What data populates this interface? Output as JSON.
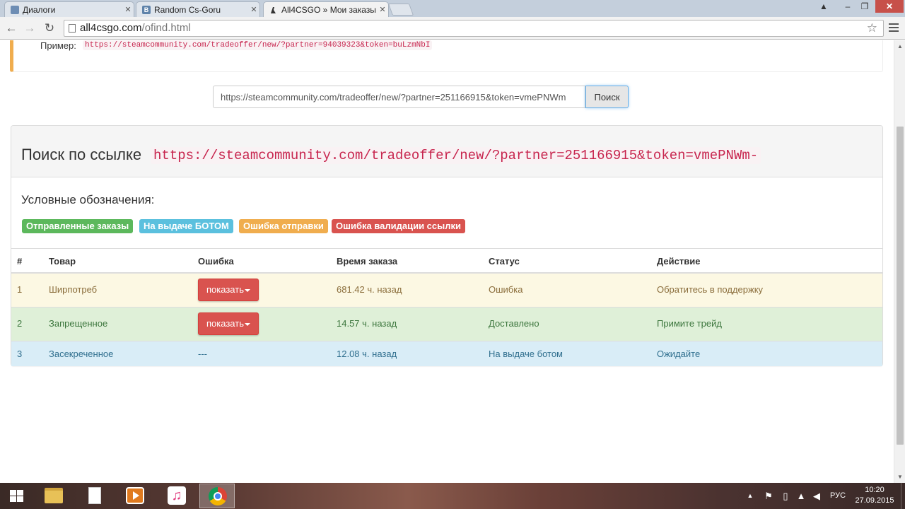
{
  "browser": {
    "tabs": [
      {
        "label": "Диалоги",
        "favicon": "vk-dialogs-icon"
      },
      {
        "label": "Random Cs-Goru",
        "favicon": "vk-icon"
      },
      {
        "label": "All4CSGO » Мои заказы",
        "favicon": "csgo-icon",
        "active": true
      }
    ],
    "url_host": "all4csgo.com",
    "url_path": "/ofind.html"
  },
  "page": {
    "example_label": "Пример:",
    "example_link": "https://steamcommunity.com/tradeoffer/new/?partner=94039323&token=buLzmNbI",
    "search_value": "https://steamcommunity.com/tradeoffer/new/?partner=251166915&token=vmePNWm",
    "search_button": "Поиск",
    "panel_title": "Поиск по ссылке",
    "panel_link": "https://steamcommunity.com/tradeoffer/new/?partner=251166915&token=vmePNWm-",
    "legend_title": "Условные обозначения:",
    "legend": {
      "sent": "Отправленные заказы",
      "bot": "На выдаче БОТОМ",
      "send_error": "Ошибка отправки",
      "validation_error": "Ошибка валидации ссылки"
    },
    "colors": {
      "success": "#5cb85c",
      "info": "#5bc0de",
      "warning": "#f0ad4e",
      "danger": "#d9534f"
    },
    "table": {
      "headers": [
        "#",
        "Товар",
        "Ошибка",
        "Время заказа",
        "Статус",
        "Действие"
      ],
      "rows": [
        {
          "num": "1",
          "item": "Ширпотреб",
          "error_button": "показать",
          "time": "681.42 ч. назад",
          "status": "Ошибка",
          "action": "Обратитесь в поддержку"
        },
        {
          "num": "2",
          "item": "Запрещенное",
          "error_button": "показать",
          "time": "14.57 ч. назад",
          "status": "Доставлено",
          "action": "Примите трейд"
        },
        {
          "num": "3",
          "item": "Засекреченное",
          "error": "---",
          "time": "12.08 ч. назад",
          "status": "На выдаче ботом",
          "action": "Ожидайте"
        }
      ]
    }
  },
  "taskbar": {
    "lang": "РУС",
    "time": "10:20",
    "date": "27.09.2015"
  }
}
